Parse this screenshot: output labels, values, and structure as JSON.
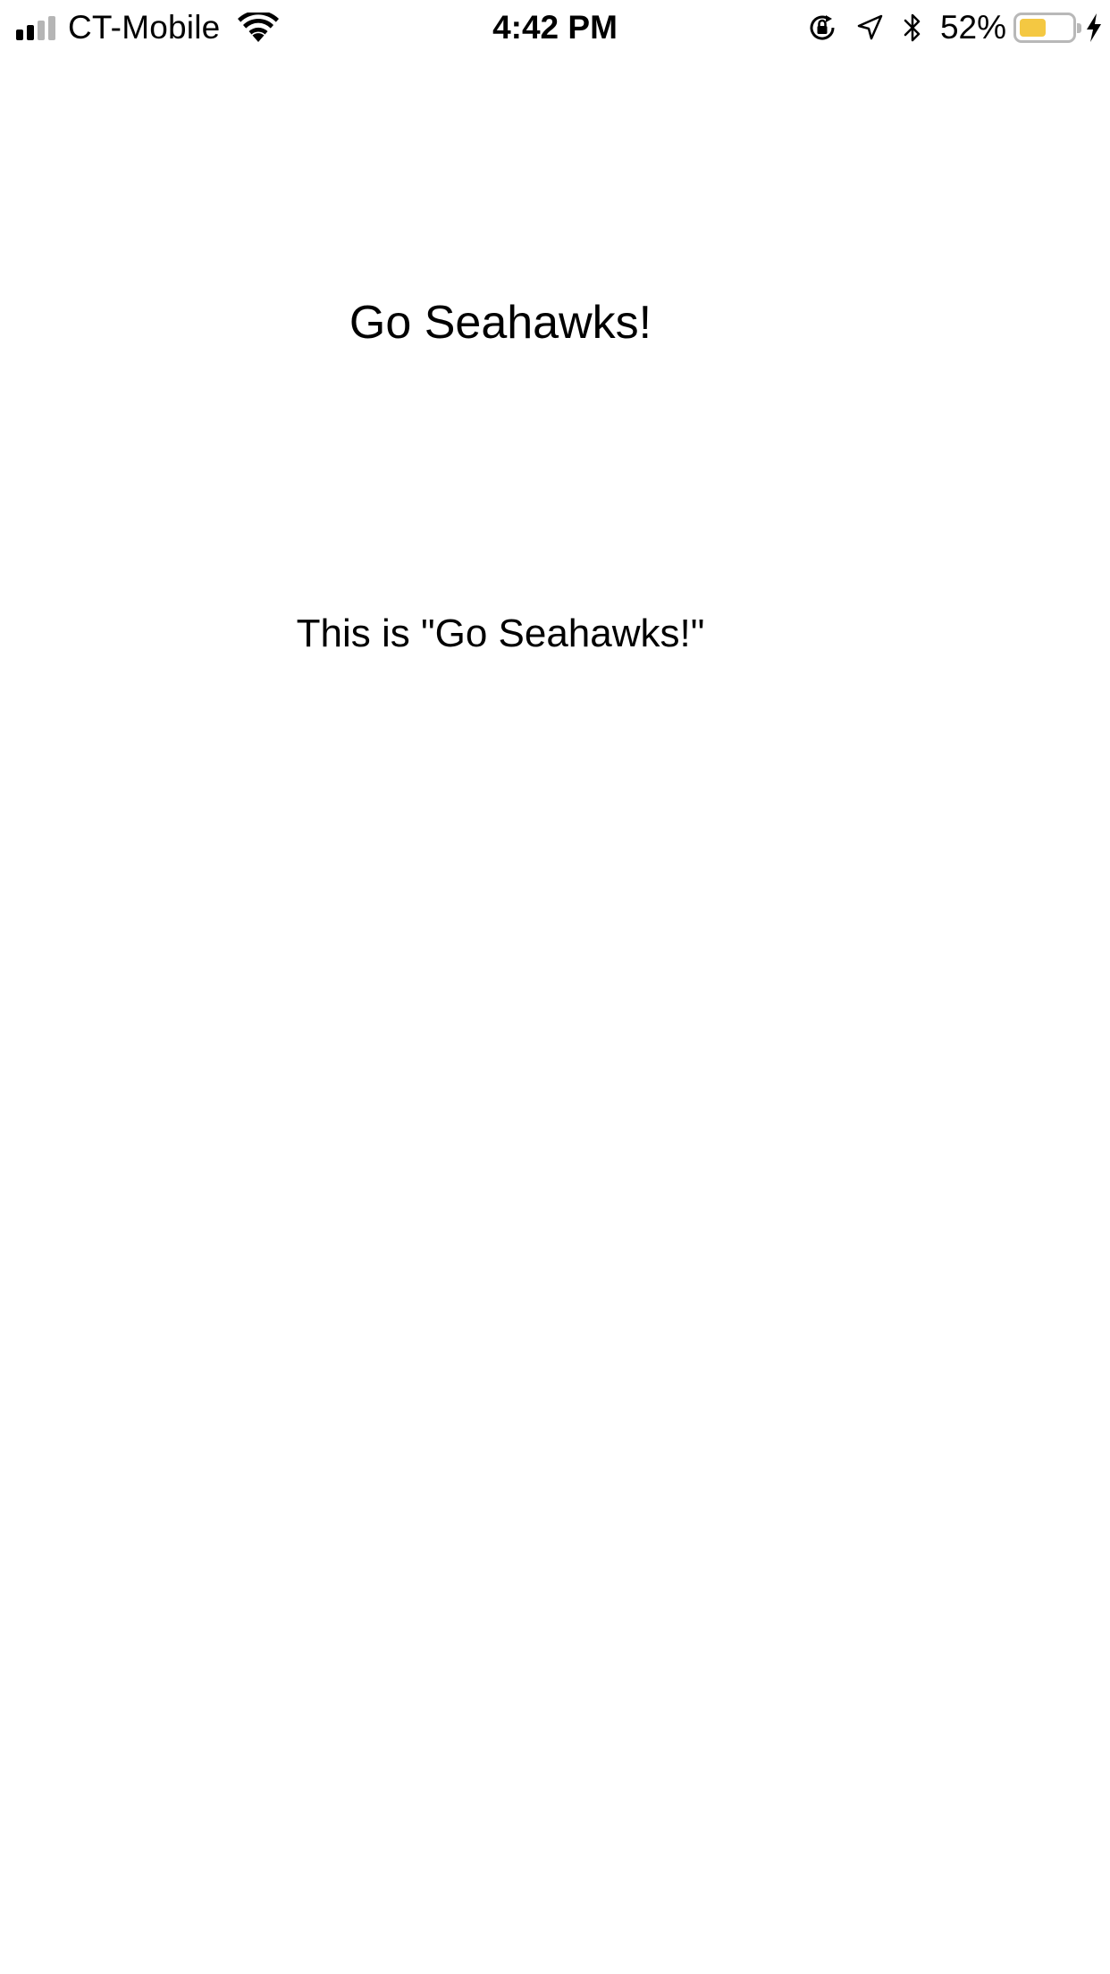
{
  "status_bar": {
    "carrier": "CT-Mobile",
    "time": "4:42 PM",
    "battery_percent": "52%",
    "battery_level": 0.52,
    "signal_bars_active": 2,
    "signal_bars_total": 4,
    "icons": [
      "signal-icon",
      "wifi-icon",
      "orientation-lock-icon",
      "location-icon",
      "bluetooth-icon",
      "battery-icon",
      "charging-icon"
    ],
    "colors": {
      "text": "#000000",
      "signal_active": "#000000",
      "signal_inactive": "#b5b5b5",
      "battery_fill": "#f4c842"
    }
  },
  "main": {
    "title": "Go Seahawks!",
    "caption": "This is \"Go Seahawks!\""
  }
}
